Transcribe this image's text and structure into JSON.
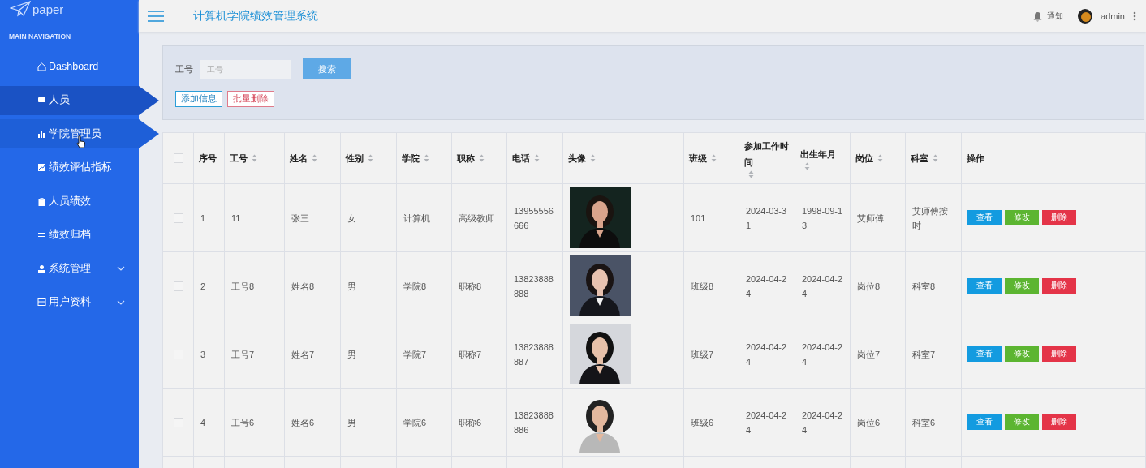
{
  "sidebar": {
    "logo": "paper",
    "section_title": "MAIN NAVIGATION",
    "items": [
      {
        "label": "Dashboard",
        "selected": false,
        "hovered": false,
        "expandable": false
      },
      {
        "label": "人员",
        "selected": true,
        "hovered": false,
        "expandable": false
      },
      {
        "label": "学院管理员",
        "selected": false,
        "hovered": true,
        "expandable": false
      },
      {
        "label": "绩效评估指标",
        "selected": false,
        "hovered": false,
        "expandable": false
      },
      {
        "label": "人员绩效",
        "selected": false,
        "hovered": false,
        "expandable": false
      },
      {
        "label": "绩效归档",
        "selected": false,
        "hovered": false,
        "expandable": false
      },
      {
        "label": "系统管理",
        "selected": false,
        "hovered": false,
        "expandable": true
      },
      {
        "label": "用户资料",
        "selected": false,
        "hovered": false,
        "expandable": true
      }
    ]
  },
  "header": {
    "title": "计算机学院绩效管理系统",
    "notification": "通知",
    "user": "admin"
  },
  "search": {
    "label": "工号",
    "placeholder": "工号",
    "search_button": "搜索",
    "add_button": "添加信息",
    "batch_delete_button": "批量删除"
  },
  "table": {
    "select_all_checked": false,
    "columns": [
      {
        "label": "序号",
        "sortable": false
      },
      {
        "label": "工号",
        "sortable": true
      },
      {
        "label": "姓名",
        "sortable": true
      },
      {
        "label": "性别",
        "sortable": true
      },
      {
        "label": "学院",
        "sortable": true
      },
      {
        "label": "职称",
        "sortable": true
      },
      {
        "label": "电话",
        "sortable": true
      },
      {
        "label": "头像",
        "sortable": true
      },
      {
        "label": "班级",
        "sortable": true
      },
      {
        "label": "参加工作时间",
        "sortable": true
      },
      {
        "label": "出生年月",
        "sortable": true
      },
      {
        "label": "岗位",
        "sortable": true
      },
      {
        "label": "科室",
        "sortable": true
      },
      {
        "label": "操作",
        "sortable": false
      }
    ],
    "rows": [
      {
        "checked": false,
        "cells": [
          "1",
          "11",
          "张三",
          "女",
          "计算机",
          "高级教师",
          "13955556666",
          null,
          "101",
          "2024-03-31",
          "1998-09-13",
          "艾师傅",
          "艾师傅按时"
        ],
        "actions": [
          "查看",
          "修改",
          "删除"
        ]
      },
      {
        "checked": false,
        "cells": [
          "2",
          "工号8",
          "姓名8",
          "男",
          "学院8",
          "职称8",
          "13823888888",
          null,
          "班级8",
          "2024-04-24",
          "2024-04-24",
          "岗位8",
          "科室8"
        ],
        "actions": [
          "查看",
          "修改",
          "删除"
        ]
      },
      {
        "checked": false,
        "cells": [
          "3",
          "工号7",
          "姓名7",
          "男",
          "学院7",
          "职称7",
          "13823888887",
          null,
          "班级7",
          "2024-04-24",
          "2024-04-24",
          "岗位7",
          "科室7"
        ],
        "actions": [
          "查看",
          "修改",
          "删除"
        ]
      },
      {
        "checked": false,
        "cells": [
          "4",
          "工号6",
          "姓名6",
          "男",
          "学院6",
          "职称6",
          "13823888886",
          null,
          "班级6",
          "2024-04-24",
          "2024-04-24",
          "岗位6",
          "科室6"
        ],
        "actions": [
          "查看",
          "修改",
          "删除"
        ]
      }
    ]
  }
}
